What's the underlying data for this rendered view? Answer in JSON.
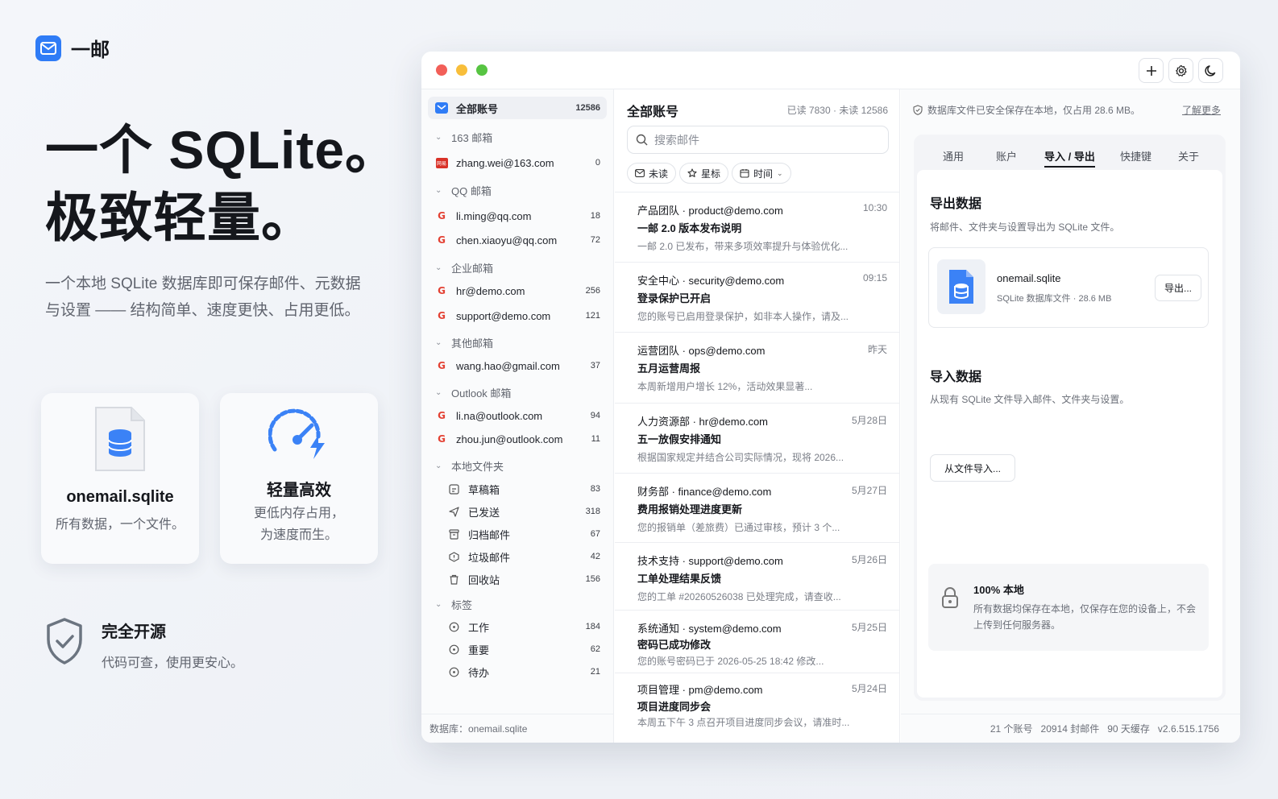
{
  "brand": {
    "name": "一邮"
  },
  "hero": {
    "line1": "一个 SQLite。",
    "line2": "极致轻量。"
  },
  "hero_sub": "一个本地 SQLite 数据库即可保存邮件、元数据与设置 —— 结构简单、速度更快、占用更低。",
  "cards": [
    {
      "title": "onemail.sqlite",
      "desc": "所有数据，一个文件。"
    },
    {
      "title": "轻量高效",
      "desc_line1": "更低内存占用，",
      "desc_line2": "为速度而生。"
    }
  ],
  "open_source": {
    "title": "完全开源",
    "desc": "代码可查，使用更安心。"
  },
  "sidebar": {
    "all": {
      "label": "全部账号",
      "count": "12586"
    },
    "groups": [
      {
        "name": "163 邮箱",
        "accounts": [
          {
            "email": "zhang.wei@163.com",
            "count": "0",
            "icon": "163-icon"
          }
        ]
      },
      {
        "name": "QQ 邮箱",
        "accounts": [
          {
            "email": "li.ming@qq.com",
            "count": "18",
            "icon": "google-icon"
          },
          {
            "email": "chen.xiaoyu@qq.com",
            "count": "72",
            "icon": "google-icon"
          }
        ]
      },
      {
        "name": "企业邮箱",
        "accounts": [
          {
            "email": "hr@demo.com",
            "count": "256",
            "icon": "google-icon"
          },
          {
            "email": "support@demo.com",
            "count": "121",
            "icon": "google-icon"
          }
        ]
      },
      {
        "name": "其他邮箱",
        "accounts": [
          {
            "email": "wang.hao@gmail.com",
            "count": "37",
            "icon": "google-icon"
          }
        ]
      },
      {
        "name": "Outlook 邮箱",
        "accounts": [
          {
            "email": "li.na@outlook.com",
            "count": "94",
            "icon": "google-icon"
          },
          {
            "email": "zhou.jun@outlook.com",
            "count": "11",
            "icon": "google-icon"
          }
        ]
      }
    ],
    "local_group": "本地文件夹",
    "folders": [
      {
        "label": "草稿箱",
        "count": "83",
        "icon": "draft-icon"
      },
      {
        "label": "已发送",
        "count": "318",
        "icon": "send-icon"
      },
      {
        "label": "归档邮件",
        "count": "67",
        "icon": "archive-icon"
      },
      {
        "label": "垃圾邮件",
        "count": "42",
        "icon": "spam-icon"
      },
      {
        "label": "回收站",
        "count": "156",
        "icon": "trash-icon"
      }
    ],
    "tag_group": "标签",
    "tags": [
      {
        "label": "工作",
        "count": "184"
      },
      {
        "label": "重要",
        "count": "62"
      },
      {
        "label": "待办",
        "count": "21"
      }
    ],
    "footer": "数据库：onemail.sqlite"
  },
  "maillist": {
    "title": "全部账号",
    "stat": "已读 7830 · 未读 12586",
    "search_placeholder": "搜索邮件",
    "chips": {
      "unread": "未读",
      "star": "星标",
      "time": "时间"
    },
    "mails": [
      {
        "from": "产品团队 · product@demo.com",
        "time": "10:30",
        "subject": "一邮 2.0 版本发布说明",
        "preview": "一邮 2.0 已发布，带来多项效率提升与体验优化..."
      },
      {
        "from": "安全中心 · security@demo.com",
        "time": "09:15",
        "subject": "登录保护已开启",
        "preview": "您的账号已启用登录保护，如非本人操作，请及..."
      },
      {
        "from": "运营团队 · ops@demo.com",
        "time": "昨天",
        "subject": "五月运营周报",
        "preview": "本周新增用户增长 12%，活动效果显著..."
      },
      {
        "from": "人力资源部 · hr@demo.com",
        "time": "5月28日",
        "subject": "五一放假安排通知",
        "preview": "根据国家规定并结合公司实际情况，现将 2026..."
      },
      {
        "from": "财务部 · finance@demo.com",
        "time": "5月27日",
        "subject": "费用报销处理进度更新",
        "preview": "您的报销单（差旅费）已通过审核，预计 3 个..."
      },
      {
        "from": "技术支持 · support@demo.com",
        "time": "5月26日",
        "subject": "工单处理结果反馈",
        "preview": "您的工单 #20260526038 已处理完成，请查收..."
      },
      {
        "from": "系统通知 · system@demo.com",
        "time": "5月25日",
        "subject": "密码已成功修改",
        "preview": "您的账号密码已于 2026-05-25 18:42 修改..."
      },
      {
        "from": "项目管理 · pm@demo.com",
        "time": "5月24日",
        "subject": "项目进度同步会",
        "preview": "本周五下午 3 点召开项目进度同步会议，请准时..."
      }
    ]
  },
  "pane": {
    "note": "数据库文件已安全保存在本地，仅占用 28.6 MB。",
    "more": "了解更多",
    "tabs": [
      "通用",
      "账户",
      "导入 / 导出",
      "快捷键",
      "关于"
    ],
    "active_tab": "导入 / 导出",
    "export": {
      "title": "导出数据",
      "desc": "将邮件、文件夹与设置导出为 SQLite 文件。",
      "file_name": "onemail.sqlite",
      "file_meta": "SQLite 数据库文件 · 28.6 MB",
      "button": "导出..."
    },
    "import": {
      "title": "导入数据",
      "desc": "从现有 SQLite 文件导入邮件、文件夹与设置。",
      "button": "从文件导入..."
    },
    "local": {
      "title": "100% 本地",
      "desc": "所有数据均保存在本地，仅保存在您的设备上，不会上传到任何服务器。"
    },
    "footer": "21 个账号   20914 封邮件   90 天缓存   v2.6.515.1756"
  },
  "colors": {
    "accent": "#2f7cf6",
    "close": "#f25f58",
    "minimize": "#f8be3a",
    "maximize": "#57c442"
  }
}
